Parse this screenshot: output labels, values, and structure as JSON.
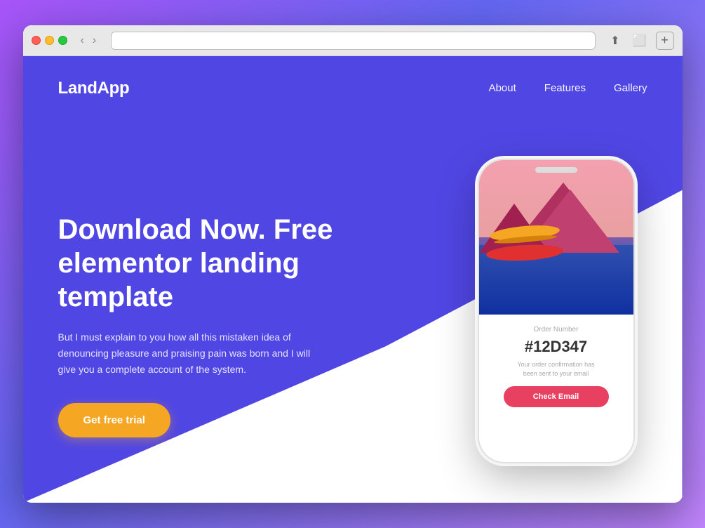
{
  "browser": {
    "traffic_lights": [
      "red",
      "yellow",
      "green"
    ],
    "nav_back": "‹",
    "nav_forward": "›",
    "new_tab_label": "+",
    "share_icon": "↑",
    "expand_icon": "⬜"
  },
  "site": {
    "logo": "LandApp",
    "nav_links": [
      "About",
      "Features",
      "Gallery"
    ],
    "hero": {
      "title": "Download Now. Free elementor landing template",
      "description": "But I must explain to you how all this mistaken idea of denouncing pleasure and praising pain was born and I will give you a complete account of the system.",
      "cta_label": "Get free trial"
    },
    "phone": {
      "order_label": "Order Number",
      "order_number": "#12D347",
      "order_message": "Your order confirmation has been sent to your email",
      "check_email_label": "Check Email"
    }
  }
}
